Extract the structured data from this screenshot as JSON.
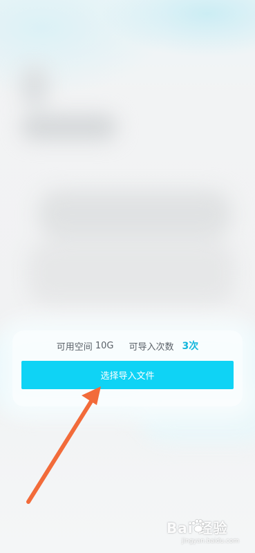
{
  "storage": {
    "available_label": "可用空间",
    "available_value": "10G",
    "imports_label": "可导入次数",
    "imports_count": "3次"
  },
  "primary_action": {
    "label": "选择导入文件"
  },
  "annotation": {
    "arrow_color": "#f26b3a",
    "icon": "arrow-annotation-icon"
  },
  "watermark": {
    "text": "Bai  经验",
    "url": "jingyan.baidu.com"
  },
  "colors": {
    "accent": "#0fd3f5",
    "count_highlight": "#13b6dc",
    "text_secondary": "#5a6168"
  }
}
